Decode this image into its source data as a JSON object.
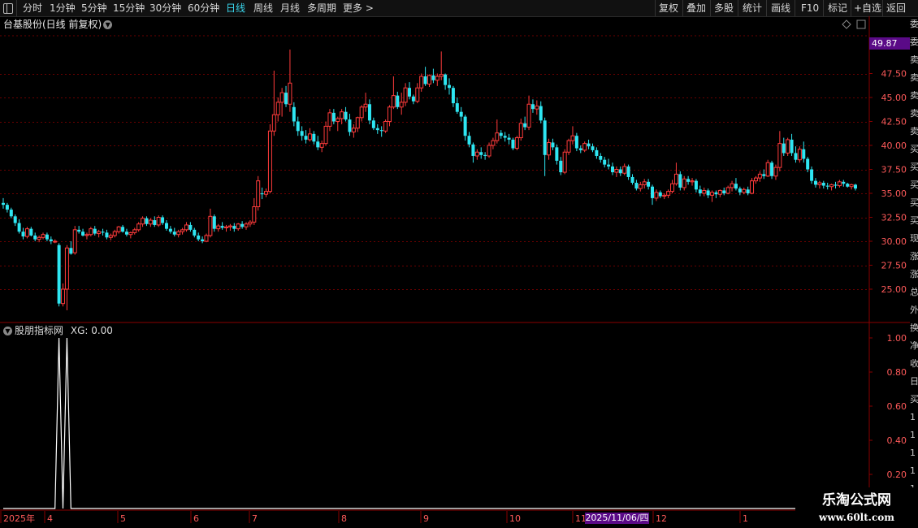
{
  "toolbar": {
    "periods": [
      "分时",
      "1分钟",
      "5分钟",
      "15分钟",
      "30分钟",
      "60分钟",
      "日线",
      "周线",
      "月线",
      "多周期",
      "更多 >"
    ],
    "active_period": "日线",
    "right_buttons": [
      "复权",
      "叠加",
      "多股",
      "统计",
      "画线",
      "F10",
      "标记",
      "+自选",
      "返回"
    ]
  },
  "chart": {
    "title": "台基股份(日线 前复权)",
    "current_price_badge": "49.87",
    "y_ticks": [
      "47.50",
      "45.00",
      "42.50",
      "40.00",
      "37.50",
      "35.00",
      "32.50",
      "30.00",
      "27.50",
      "25.00"
    ]
  },
  "indicator": {
    "title": "股朋指标网",
    "value_label": "XG: 0.00",
    "y_ticks": [
      "1.00",
      "0.80",
      "0.60",
      "0.40",
      "0.20"
    ]
  },
  "x_axis": {
    "labels": [
      "2025年",
      "4",
      "5",
      "6",
      "7",
      "8",
      "9",
      "10",
      "11",
      "12",
      "1"
    ],
    "cursor_date": "2025/11/06/四"
  },
  "watermark": {
    "line1": "乐淘公式网",
    "line2": "www.60lt.com"
  },
  "right_strip": [
    "委",
    "委",
    "卖",
    "卖",
    "卖",
    "卖",
    "卖",
    "买",
    "买",
    "买",
    "买",
    "买",
    "现",
    "涨",
    "涨",
    "总",
    "外",
    "换",
    "净",
    "收",
    "日",
    "买",
    "1",
    "1",
    "1",
    "1",
    "1",
    "1"
  ],
  "colors": {
    "up": "#ff3b3b",
    "down": "#2ee6f2",
    "grid": "#6a0000",
    "active": "#3ad7ee",
    "badge": "#5a0a87"
  },
  "chart_data": {
    "type": "candlestick",
    "ylim": [
      22.5,
      50.5
    ],
    "x_month_labels": [
      "2025年",
      "4",
      "5",
      "6",
      "7",
      "8",
      "9",
      "10",
      "11",
      "12",
      "1"
    ],
    "candles": [
      [
        34.0,
        34.5,
        33.4,
        33.8
      ],
      [
        33.8,
        34.0,
        33.0,
        33.3
      ],
      [
        33.3,
        33.5,
        32.4,
        32.6
      ],
      [
        32.6,
        32.8,
        31.6,
        31.9
      ],
      [
        31.9,
        32.3,
        30.8,
        31.0
      ],
      [
        31.0,
        31.4,
        30.2,
        30.5
      ],
      [
        30.5,
        31.5,
        30.3,
        31.3
      ],
      [
        31.3,
        31.5,
        30.5,
        30.6
      ],
      [
        30.6,
        30.9,
        30.0,
        30.2
      ],
      [
        30.2,
        30.6,
        29.9,
        30.4
      ],
      [
        30.4,
        30.9,
        30.2,
        30.7
      ],
      [
        30.7,
        30.9,
        30.0,
        30.2
      ],
      [
        30.2,
        30.5,
        29.7,
        30.0
      ],
      [
        30.0,
        30.2,
        29.8,
        30.0
      ],
      [
        29.6,
        29.8,
        23.2,
        23.5
      ],
      [
        23.5,
        25.6,
        23.2,
        25.0
      ],
      [
        25.0,
        29.6,
        22.8,
        29.3
      ],
      [
        29.3,
        30.0,
        28.6,
        28.7
      ],
      [
        28.8,
        31.6,
        28.6,
        31.2
      ],
      [
        31.2,
        31.6,
        30.8,
        31.0
      ],
      [
        31.0,
        31.3,
        30.5,
        30.6
      ],
      [
        30.6,
        30.9,
        30.2,
        30.7
      ],
      [
        30.7,
        31.5,
        30.5,
        31.3
      ],
      [
        31.3,
        31.6,
        30.6,
        30.8
      ],
      [
        30.8,
        31.2,
        30.4,
        31.0
      ],
      [
        31.0,
        31.3,
        30.6,
        30.9
      ],
      [
        30.9,
        31.2,
        30.2,
        30.4
      ],
      [
        30.4,
        30.8,
        30.1,
        30.6
      ],
      [
        30.6,
        31.2,
        30.4,
        31.0
      ],
      [
        31.0,
        31.6,
        30.8,
        31.5
      ],
      [
        31.5,
        31.7,
        30.9,
        31.0
      ],
      [
        31.0,
        31.3,
        30.5,
        30.7
      ],
      [
        30.7,
        31.0,
        30.3,
        30.9
      ],
      [
        30.9,
        31.4,
        30.7,
        31.2
      ],
      [
        31.2,
        32.0,
        31.0,
        31.8
      ],
      [
        31.8,
        32.6,
        31.5,
        32.4
      ],
      [
        32.4,
        32.6,
        31.6,
        31.8
      ],
      [
        31.8,
        32.4,
        31.5,
        32.2
      ],
      [
        32.2,
        32.6,
        31.5,
        31.7
      ],
      [
        31.7,
        32.7,
        31.5,
        32.5
      ],
      [
        32.5,
        32.7,
        31.7,
        31.9
      ],
      [
        31.9,
        32.2,
        31.1,
        31.3
      ],
      [
        31.3,
        31.6,
        30.8,
        31.0
      ],
      [
        31.0,
        31.4,
        30.5,
        30.7
      ],
      [
        30.7,
        31.2,
        30.4,
        31.0
      ],
      [
        31.0,
        31.4,
        30.7,
        31.2
      ],
      [
        31.2,
        32.0,
        31.0,
        31.7
      ],
      [
        31.7,
        32.0,
        31.0,
        31.2
      ],
      [
        31.2,
        31.4,
        30.4,
        30.6
      ],
      [
        30.6,
        30.9,
        30.0,
        30.2
      ],
      [
        30.2,
        30.5,
        29.8,
        30.0
      ],
      [
        30.0,
        30.8,
        29.9,
        30.6
      ],
      [
        30.6,
        33.4,
        30.4,
        32.6
      ],
      [
        32.6,
        32.8,
        31.0,
        31.3
      ],
      [
        31.3,
        31.8,
        31.0,
        31.6
      ],
      [
        31.6,
        32.0,
        31.2,
        31.4
      ],
      [
        31.4,
        31.7,
        31.0,
        31.5
      ],
      [
        31.5,
        31.8,
        31.1,
        31.6
      ],
      [
        31.6,
        31.9,
        31.0,
        31.3
      ],
      [
        31.3,
        31.9,
        31.1,
        31.8
      ],
      [
        31.8,
        32.1,
        31.3,
        31.5
      ],
      [
        31.5,
        32.0,
        31.2,
        31.8
      ],
      [
        31.8,
        32.2,
        31.5,
        32.0
      ],
      [
        32.0,
        34.5,
        31.7,
        33.6
      ],
      [
        33.6,
        36.8,
        33.2,
        36.3
      ],
      [
        35.0,
        35.6,
        34.4,
        34.9
      ],
      [
        34.9,
        35.5,
        34.6,
        35.2
      ],
      [
        35.2,
        42.2,
        35.0,
        41.5
      ],
      [
        41.5,
        47.8,
        41.0,
        43.2
      ],
      [
        43.2,
        45.0,
        42.5,
        44.5
      ],
      [
        44.5,
        46.0,
        43.0,
        45.5
      ],
      [
        45.5,
        46.2,
        44.0,
        44.3
      ],
      [
        44.3,
        50.0,
        43.5,
        46.5
      ],
      [
        44.0,
        44.5,
        42.0,
        42.5
      ],
      [
        42.5,
        43.0,
        41.0,
        41.5
      ],
      [
        41.5,
        42.0,
        40.5,
        41.0
      ],
      [
        41.0,
        41.6,
        40.2,
        40.6
      ],
      [
        40.6,
        41.8,
        40.4,
        41.2
      ],
      [
        41.2,
        41.5,
        40.1,
        40.4
      ],
      [
        40.4,
        41.0,
        39.5,
        39.8
      ],
      [
        39.8,
        40.5,
        39.3,
        40.2
      ],
      [
        40.2,
        42.5,
        40.0,
        42.0
      ],
      [
        42.0,
        43.8,
        41.5,
        43.4
      ],
      [
        43.4,
        43.8,
        42.2,
        42.5
      ],
      [
        42.5,
        43.0,
        41.5,
        42.8
      ],
      [
        42.8,
        43.8,
        42.2,
        43.5
      ],
      [
        43.5,
        44.0,
        42.5,
        42.7
      ],
      [
        42.7,
        43.3,
        41.0,
        41.4
      ],
      [
        41.4,
        42.2,
        40.8,
        41.8
      ],
      [
        41.8,
        43.0,
        41.4,
        42.9
      ],
      [
        42.9,
        44.2,
        42.5,
        44.0
      ],
      [
        44.0,
        45.5,
        43.5,
        44.3
      ],
      [
        44.3,
        44.8,
        42.2,
        42.6
      ],
      [
        42.6,
        42.9,
        41.6,
        41.8
      ],
      [
        41.8,
        42.2,
        41.2,
        41.6
      ],
      [
        41.6,
        42.0,
        40.9,
        41.5
      ],
      [
        41.5,
        42.7,
        41.3,
        42.5
      ],
      [
        42.5,
        44.2,
        42.0,
        44.0
      ],
      [
        44.0,
        47.2,
        43.8,
        45.2
      ],
      [
        45.2,
        45.6,
        43.8,
        44.0
      ],
      [
        44.0,
        45.5,
        43.2,
        44.5
      ],
      [
        44.5,
        46.5,
        44.1,
        46.0
      ],
      [
        46.0,
        46.6,
        44.8,
        45.1
      ],
      [
        45.1,
        45.3,
        44.3,
        44.6
      ],
      [
        44.6,
        46.5,
        44.4,
        46.0
      ],
      [
        46.0,
        47.5,
        45.6,
        47.2
      ],
      [
        47.2,
        48.2,
        46.2,
        46.4
      ],
      [
        46.4,
        47.4,
        46.1,
        47.3
      ],
      [
        47.3,
        48.0,
        46.5,
        46.8
      ],
      [
        46.8,
        47.5,
        46.2,
        47.2
      ],
      [
        47.2,
        49.8,
        46.8,
        47.4
      ],
      [
        47.4,
        47.5,
        45.8,
        46.3
      ],
      [
        46.3,
        47.0,
        45.3,
        46.0
      ],
      [
        46.0,
        46.2,
        44.0,
        44.4
      ],
      [
        44.4,
        45.0,
        43.3,
        43.5
      ],
      [
        43.5,
        44.0,
        42.5,
        43.0
      ],
      [
        43.0,
        43.2,
        40.5,
        41.0
      ],
      [
        41.0,
        41.4,
        39.8,
        40.1
      ],
      [
        40.1,
        40.3,
        38.2,
        38.9
      ],
      [
        38.9,
        39.6,
        38.5,
        39.3
      ],
      [
        39.3,
        39.8,
        38.6,
        39.0
      ],
      [
        39.0,
        39.3,
        38.5,
        38.9
      ],
      [
        38.9,
        40.3,
        38.7,
        40.0
      ],
      [
        40.0,
        40.8,
        39.6,
        40.5
      ],
      [
        40.5,
        42.7,
        40.2,
        41.3
      ],
      [
        41.3,
        41.6,
        40.7,
        41.0
      ],
      [
        41.0,
        41.4,
        40.4,
        40.8
      ],
      [
        40.8,
        41.2,
        40.1,
        40.6
      ],
      [
        40.6,
        40.8,
        39.5,
        39.7
      ],
      [
        39.7,
        41.0,
        39.5,
        40.8
      ],
      [
        40.8,
        42.8,
        40.5,
        42.3
      ],
      [
        42.3,
        43.0,
        41.6,
        41.9
      ],
      [
        41.9,
        45.2,
        41.6,
        44.3
      ],
      [
        44.3,
        44.8,
        43.4,
        43.8
      ],
      [
        43.8,
        44.7,
        43.2,
        44.1
      ],
      [
        44.1,
        44.6,
        42.3,
        42.6
      ],
      [
        42.6,
        42.9,
        36.8,
        39.0
      ],
      [
        39.0,
        40.7,
        38.5,
        40.3
      ],
      [
        40.3,
        40.7,
        39.5,
        39.8
      ],
      [
        39.8,
        40.1,
        38.0,
        38.4
      ],
      [
        38.4,
        38.8,
        36.9,
        37.2
      ],
      [
        37.2,
        39.6,
        37.0,
        39.3
      ],
      [
        39.3,
        40.7,
        39.0,
        40.5
      ],
      [
        40.5,
        42.0,
        40.1,
        41.0
      ],
      [
        41.0,
        41.3,
        39.4,
        39.7
      ],
      [
        39.7,
        40.0,
        39.2,
        39.5
      ],
      [
        39.5,
        40.4,
        39.3,
        40.2
      ],
      [
        40.2,
        40.6,
        39.6,
        39.9
      ],
      [
        39.9,
        40.2,
        39.3,
        39.5
      ],
      [
        39.5,
        39.8,
        38.6,
        38.9
      ],
      [
        38.9,
        39.2,
        38.2,
        38.5
      ],
      [
        38.5,
        38.8,
        37.7,
        38.0
      ],
      [
        38.0,
        38.6,
        37.5,
        37.8
      ],
      [
        37.8,
        38.2,
        36.9,
        37.2
      ],
      [
        37.2,
        37.8,
        36.7,
        37.5
      ],
      [
        37.5,
        37.8,
        36.8,
        37.1
      ],
      [
        37.1,
        38.1,
        36.9,
        37.8
      ],
      [
        37.8,
        38.0,
        36.4,
        36.7
      ],
      [
        36.7,
        37.0,
        35.9,
        36.1
      ],
      [
        36.1,
        36.4,
        35.3,
        35.5
      ],
      [
        35.5,
        36.2,
        35.2,
        35.9
      ],
      [
        35.9,
        36.5,
        35.5,
        36.2
      ],
      [
        36.2,
        36.5,
        35.4,
        35.7
      ],
      [
        35.7,
        35.9,
        33.8,
        34.5
      ],
      [
        34.5,
        35.4,
        34.2,
        35.1
      ],
      [
        35.1,
        35.3,
        34.5,
        34.7
      ],
      [
        34.7,
        35.0,
        34.4,
        34.8
      ],
      [
        34.8,
        35.4,
        34.5,
        35.2
      ],
      [
        35.2,
        36.4,
        35.0,
        36.0
      ],
      [
        36.0,
        38.2,
        35.8,
        37.0
      ],
      [
        37.0,
        37.3,
        35.3,
        35.6
      ],
      [
        35.6,
        36.8,
        35.3,
        36.5
      ],
      [
        36.5,
        36.8,
        35.9,
        36.2
      ],
      [
        36.2,
        36.6,
        35.8,
        36.3
      ],
      [
        36.3,
        36.5,
        35.1,
        35.4
      ],
      [
        35.4,
        35.8,
        34.7,
        35.0
      ],
      [
        35.0,
        35.6,
        34.7,
        35.3
      ],
      [
        35.3,
        35.5,
        34.5,
        34.8
      ],
      [
        34.8,
        35.3,
        34.1,
        35.1
      ],
      [
        35.1,
        35.3,
        34.5,
        34.9
      ],
      [
        34.9,
        35.4,
        34.6,
        35.3
      ],
      [
        35.3,
        35.6,
        34.8,
        35.0
      ],
      [
        35.0,
        35.8,
        34.9,
        35.6
      ],
      [
        35.6,
        36.3,
        35.2,
        36.0
      ],
      [
        36.0,
        36.6,
        35.3,
        35.5
      ],
      [
        35.5,
        35.7,
        34.8,
        35.1
      ],
      [
        35.1,
        35.6,
        34.9,
        35.4
      ],
      [
        35.4,
        35.7,
        34.8,
        35.0
      ],
      [
        35.0,
        36.6,
        34.9,
        36.3
      ],
      [
        36.3,
        36.8,
        36.0,
        36.6
      ],
      [
        36.6,
        37.3,
        36.2,
        37.0
      ],
      [
        37.0,
        37.5,
        36.5,
        36.8
      ],
      [
        36.8,
        38.5,
        36.7,
        38.2
      ],
      [
        38.2,
        38.4,
        36.5,
        36.8
      ],
      [
        36.8,
        38.0,
        36.4,
        37.7
      ],
      [
        37.7,
        41.5,
        37.3,
        40.2
      ],
      [
        40.2,
        40.8,
        38.9,
        39.2
      ],
      [
        39.2,
        40.8,
        38.9,
        40.6
      ],
      [
        40.6,
        41.2,
        38.9,
        39.2
      ],
      [
        39.2,
        39.9,
        38.2,
        38.5
      ],
      [
        38.5,
        39.9,
        38.2,
        39.6
      ],
      [
        39.6,
        40.4,
        38.2,
        38.6
      ],
      [
        38.6,
        38.8,
        37.2,
        37.5
      ],
      [
        37.5,
        37.8,
        36.0,
        36.3
      ],
      [
        36.3,
        36.6,
        35.6,
        35.9
      ],
      [
        35.9,
        36.3,
        35.5,
        36.1
      ],
      [
        36.1,
        36.3,
        35.5,
        35.8
      ],
      [
        35.8,
        36.1,
        35.4,
        35.7
      ],
      [
        35.7,
        36.0,
        35.3,
        35.9
      ],
      [
        35.9,
        36.2,
        35.5,
        35.8
      ],
      [
        35.8,
        36.4,
        35.6,
        36.2
      ],
      [
        36.2,
        36.4,
        35.7,
        36.0
      ],
      [
        36.0,
        36.1,
        35.6,
        35.7
      ],
      [
        35.7,
        36.0,
        35.4,
        35.9
      ],
      [
        35.9,
        36.0,
        35.3,
        35.5
      ]
    ],
    "indicator_series": {
      "name": "XG",
      "signal_days": [
        14,
        16
      ],
      "ylim": [
        0,
        1
      ]
    }
  }
}
